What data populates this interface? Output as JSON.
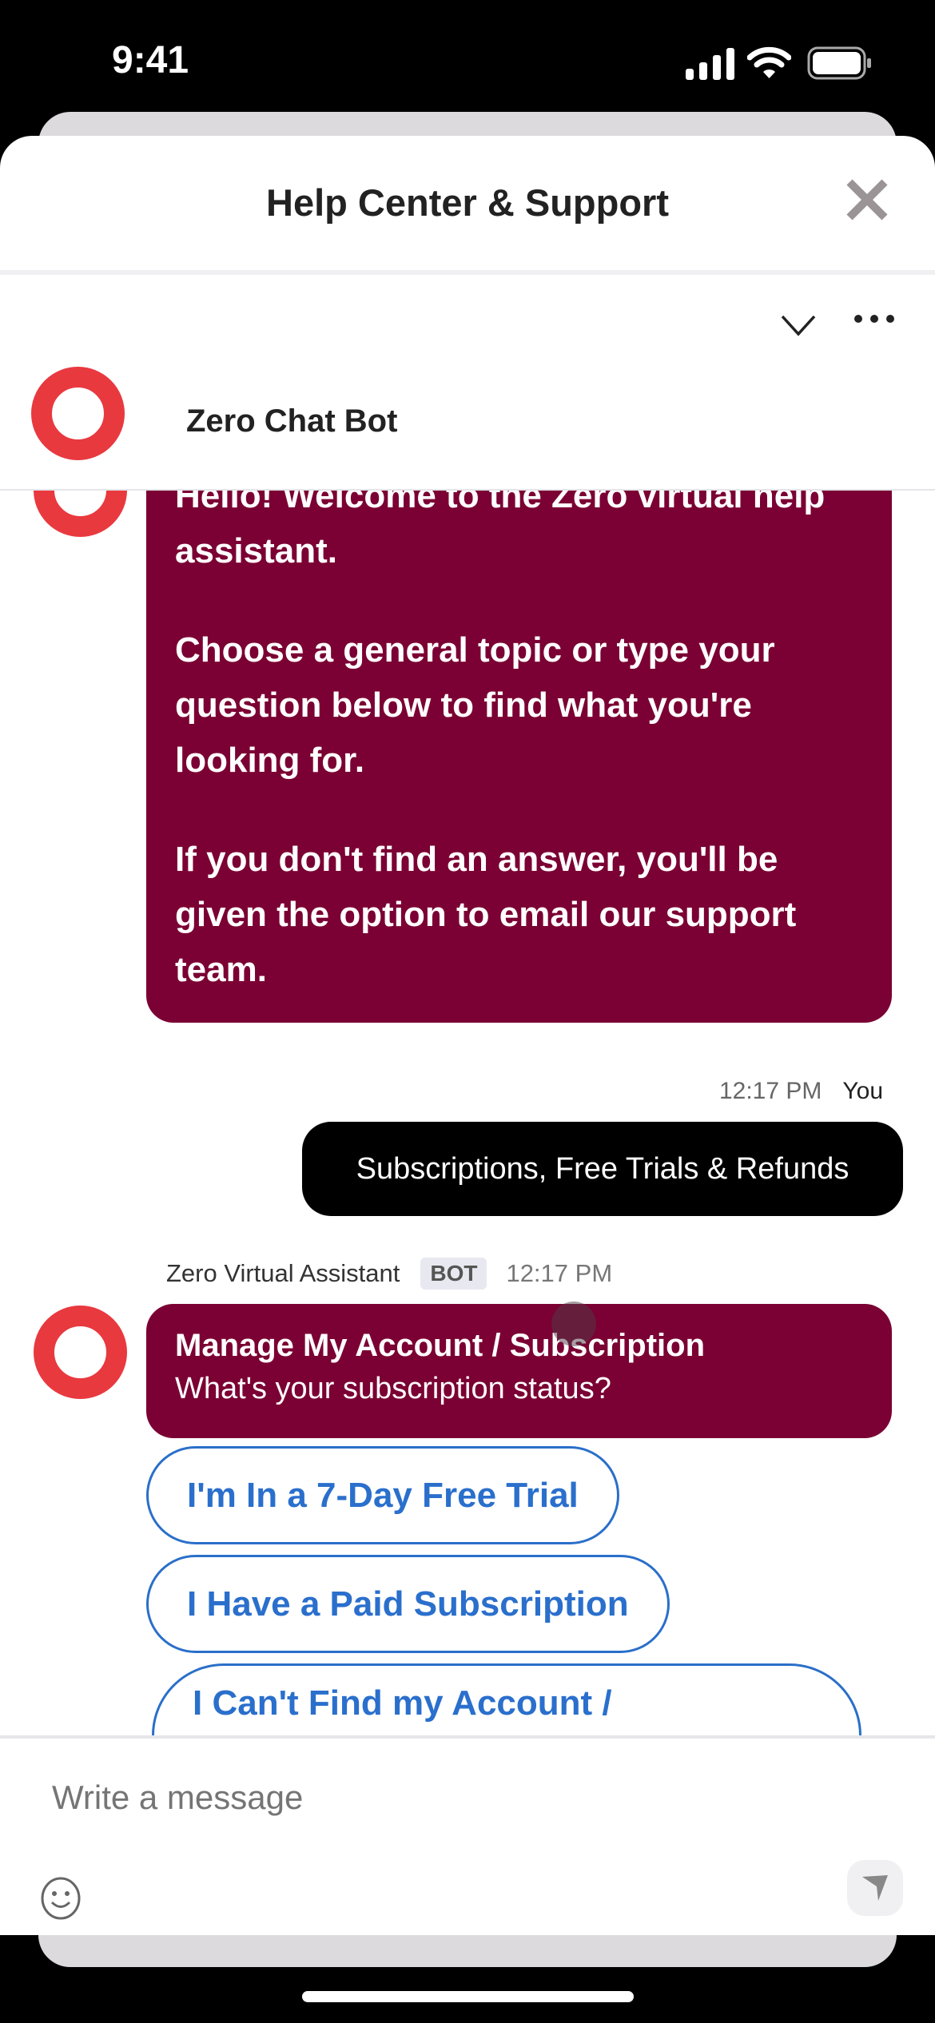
{
  "status_bar": {
    "time": "9:41",
    "icons": [
      "signal-icon",
      "wifi-icon",
      "battery-icon"
    ]
  },
  "header": {
    "title": "Help Center & Support",
    "close_icon": "close-icon"
  },
  "chat_header": {
    "bot_name": "Zero Chat Bot",
    "icons": [
      "chevron-down-icon",
      "more-icon"
    ]
  },
  "messages": {
    "welcome": [
      "Hello! Welcome to the Zero virtual help assistant.",
      "Choose a general topic or type your question below to find what you're looking for.",
      "If you don't find an answer, you'll be given the option to email our support team."
    ],
    "user": {
      "time": "12:17 PM",
      "sender": "You",
      "text": "Subscriptions, Free Trials & Refunds"
    },
    "bot": {
      "sender": "Zero Virtual Assistant",
      "badge": "BOT",
      "time": "12:17 PM",
      "title": "Manage My Account / Subscription",
      "text": "What's your subscription status?"
    },
    "options": [
      "I'm In a 7-Day Free Trial",
      "I Have a Paid Subscription",
      "I Can't Find my Account /"
    ]
  },
  "composer": {
    "placeholder": "Write a message",
    "icons": [
      "emoji-icon",
      "send-icon"
    ]
  },
  "colors": {
    "brand": "#e8393f",
    "bubble": "#7b0033",
    "link": "#2a6fcc"
  }
}
